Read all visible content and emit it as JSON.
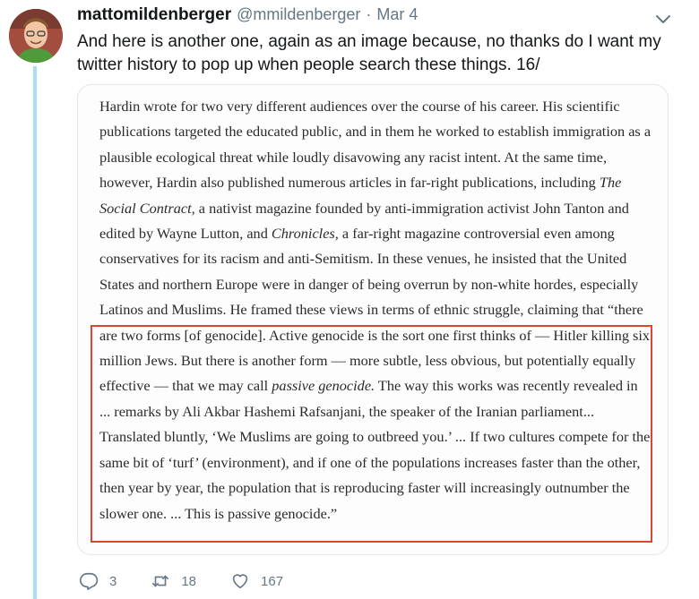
{
  "tweet": {
    "display_name": "mattomildenberger",
    "handle": "@mmildenberger",
    "separator": "·",
    "date": "Mar 4",
    "text": "And here is another one, again as an image because, no thanks do I want my twitter history to pop up when people search these things. 16/"
  },
  "image": {
    "part1": "Hardin wrote for two very different audiences over the course of his career. His scientific publications targeted the educated public, and in them he worked to establish immigration as a plausible ecological threat while loudly disavowing any racist intent. At the same time, however, Hardin also published numerous articles in far-right publications, including ",
    "italic1": "The Social Contract,",
    "part2": " a nativist magazine founded by anti-immigration activist John Tanton and edited by Wayne Lutton, and ",
    "italic2": "Chronicles,",
    "part3": " a far-right magazine controversial even among conservatives for its racism and anti-Semitism. In these venues, he insisted that the United States and northern Europe were in danger of being overrun by non-white hordes, especially Latinos and Muslims. He framed these views in terms of ethnic struggle, claiming that “there are two forms [of genocide]. Active genocide is the sort one first thinks of — Hitler killing six million Jews. But there is another form — more subtle, less obvious, but potentially equally effective — that we may call ",
    "italic3": "passive genocide.",
    "part4": " The way this works was recently revealed in ... remarks by Ali Akbar Hashemi Rafsanjani, the speaker of the Iranian parliament... Translated bluntly, ‘We Muslims are going to outbreed you.’ ... If two cultures compete for the same bit of ‘turf’ (environment), and if one of the populations increases faster than the other, then year by year, the population that is reproducing faster will increasingly outnumber the slower one. ... This is passive genocide.”",
    "highlight_color": "#d9472f"
  },
  "actions": {
    "reply_count": "3",
    "retweet_count": "18",
    "like_count": "167",
    "icons": [
      "reply-icon",
      "retweet-icon",
      "like-icon"
    ]
  },
  "colors": {
    "thread_line": "#a8dcf7",
    "secondary_text": "#657786"
  }
}
